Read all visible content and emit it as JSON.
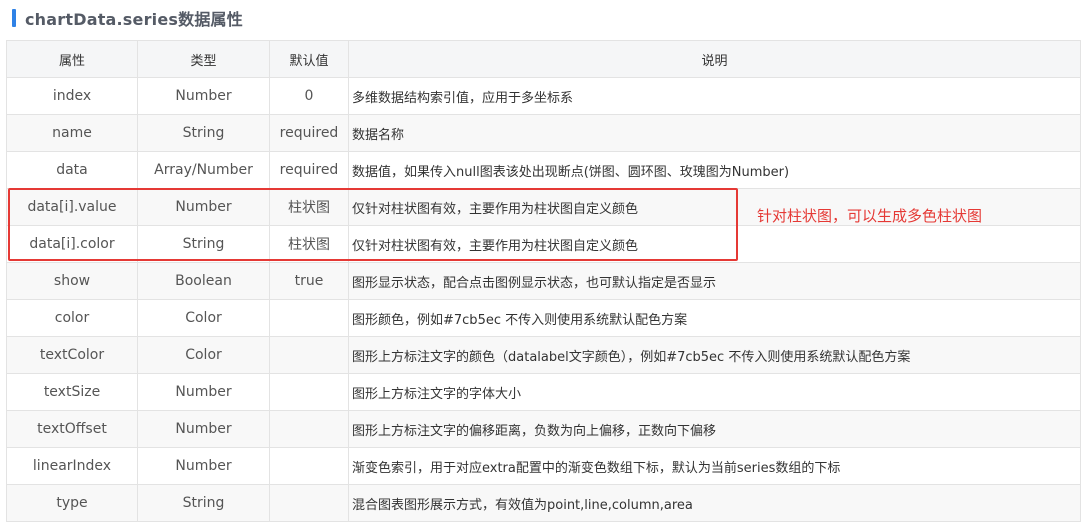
{
  "title": "chartData.series数据属性",
  "columns": [
    "属性",
    "类型",
    "默认值",
    "说明"
  ],
  "rows": [
    {
      "attr": "index",
      "type": "Number",
      "default": "0",
      "desc": "多维数据结构索引值，应用于多坐标系"
    },
    {
      "attr": "name",
      "type": "String",
      "default": "required",
      "desc": "数据名称"
    },
    {
      "attr": "data",
      "type": "Array/Number",
      "default": "required",
      "desc": "数据值，如果传入null图表该处出现断点(饼图、圆环图、玫瑰图为Number)"
    },
    {
      "attr": "data[i].value",
      "type": "Number",
      "default": "柱状图",
      "desc": "仅针对柱状图有效，主要作用为柱状图自定义颜色"
    },
    {
      "attr": "data[i].color",
      "type": "String",
      "default": "柱状图",
      "desc": "仅针对柱状图有效，主要作用为柱状图自定义颜色"
    },
    {
      "attr": "show",
      "type": "Boolean",
      "default": "true",
      "desc": "图形显示状态，配合点击图例显示状态，也可默认指定是否显示"
    },
    {
      "attr": "color",
      "type": "Color",
      "default": "",
      "desc": "图形颜色，例如#7cb5ec 不传入则使用系统默认配色方案"
    },
    {
      "attr": "textColor",
      "type": "Color",
      "default": "",
      "desc": "图形上方标注文字的颜色（datalabel文字颜色），例如#7cb5ec 不传入则使用系统默认配色方案"
    },
    {
      "attr": "textSize",
      "type": "Number",
      "default": "",
      "desc": "图形上方标注文字的字体大小"
    },
    {
      "attr": "textOffset",
      "type": "Number",
      "default": "",
      "desc": "图形上方标注文字的偏移距离，负数为向上偏移，正数向下偏移"
    },
    {
      "attr": "linearIndex",
      "type": "Number",
      "default": "",
      "desc": "渐变色索引，用于对应extra配置中的渐变色数组下标，默认为当前series数组的下标"
    },
    {
      "attr": "type",
      "type": "String",
      "default": "",
      "desc": "混合图表图形展示方式，有效值为point,line,column,area"
    }
  ],
  "annotation": "针对柱状图，可以生成多色柱状图",
  "colors": {
    "accent_bar": "#2f82e6",
    "highlight": "#e53935",
    "header_bg": "#f5f6f7",
    "stripe_bg": "#f8f8f8",
    "border": "#e3e3e3"
  }
}
